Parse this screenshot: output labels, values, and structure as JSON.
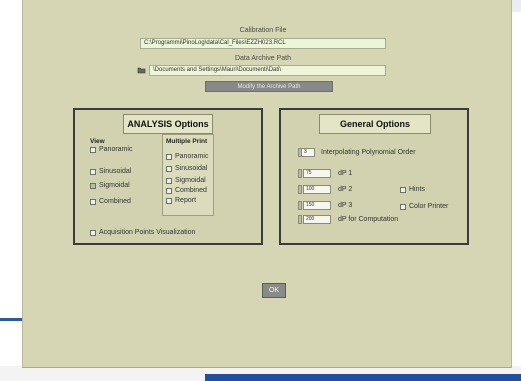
{
  "calibration": {
    "label": "Calibration File",
    "value": "C:\\Programmi\\PinoLog\\data\\Cal_Files\\EZZH023.RCL"
  },
  "archive": {
    "label": "Data Archive Path",
    "value": "\\Documents and Settings\\Mauri\\Documenti\\Dati\\",
    "modify_button": "Modify the Archive Path"
  },
  "analysis": {
    "title": "ANALYSIS Options",
    "view": {
      "title": "View",
      "items": [
        "Panoramic",
        "Sinusoidal",
        "Sigmoidal",
        "Combined"
      ]
    },
    "multiple_print": {
      "title": "Multiple Print",
      "items": [
        "Panoramic",
        "Sinusoidal",
        "Sigmoidal",
        "Combined",
        "Report"
      ]
    },
    "acquisition": "Acquisition Points Visualization"
  },
  "general": {
    "title": "General Options",
    "interp": {
      "value": "3",
      "label": "Interpolating Polynomial Order"
    },
    "dp1": {
      "value": "75",
      "label": "dP 1"
    },
    "dp2": {
      "value": "100",
      "label": "dP 2"
    },
    "dp3": {
      "value": "150",
      "label": "dP 3"
    },
    "dpc": {
      "value": "200",
      "label": "dP for Computation"
    },
    "hints": "Hints",
    "color_printer": "Color Printer"
  },
  "ok_button": "OK"
}
